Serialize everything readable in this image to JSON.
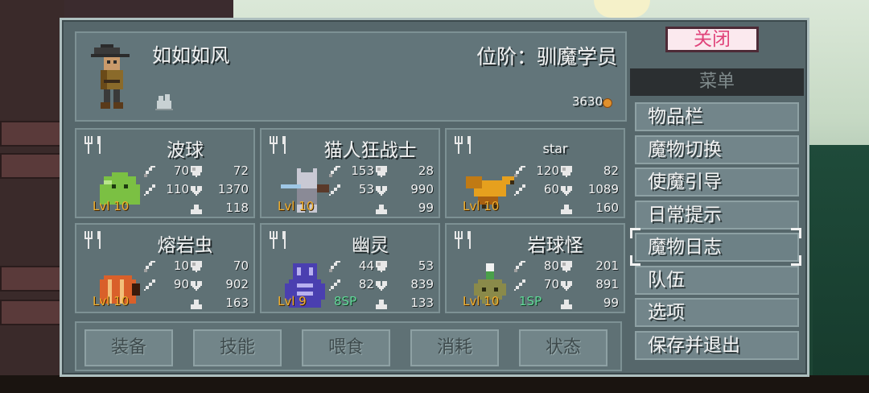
{
  "player": {
    "name": "如如如风",
    "rank": "位阶：驯魔学员",
    "gold": "3630"
  },
  "monsters": [
    {
      "name": "波球",
      "attack": "70",
      "defense": "72",
      "magic": "110",
      "hp": "1370",
      "speed": "118",
      "level": "Lvl 10",
      "sp": "",
      "color": "#7bc043"
    },
    {
      "name": "猫人狂战士",
      "attack": "153",
      "defense": "28",
      "magic": "53",
      "hp": "990",
      "speed": "99",
      "level": "Lvl 10",
      "sp": "",
      "color": "#c9c9d4"
    },
    {
      "name": "star",
      "attack": "120",
      "defense": "82",
      "magic": "60",
      "hp": "1089",
      "speed": "160",
      "level": "Lvl 10",
      "sp": "",
      "color": "#e6a01e"
    },
    {
      "name": "熔岩虫",
      "attack": "10",
      "defense": "70",
      "magic": "90",
      "hp": "902",
      "speed": "163",
      "level": "Lvl 10",
      "sp": "",
      "color": "#d9602a"
    },
    {
      "name": "幽灵",
      "attack": "44",
      "defense": "53",
      "magic": "82",
      "hp": "839",
      "speed": "133",
      "level": "Lvl 9",
      "sp": "8SP",
      "color": "#4a3fb0"
    },
    {
      "name": "岩球怪",
      "attack": "80",
      "defense": "201",
      "magic": "70",
      "hp": "891",
      "speed": "99",
      "level": "Lvl 10",
      "sp": "1SP",
      "color": "#8a8a4a"
    }
  ],
  "actions": [
    "装备",
    "技能",
    "喂食",
    "消耗",
    "状态"
  ],
  "menu": {
    "close_label": "关闭",
    "header": "菜单",
    "items": [
      "物品栏",
      "魔物切换",
      "使魔引导",
      "日常提示",
      "魔物日志",
      "队伍",
      "选项",
      "保存并退出"
    ],
    "selected": "魔物日志"
  },
  "colors": {
    "level": "#f2b02e",
    "sp": "#63d79a",
    "close_text": "#e0447a",
    "gold_coin": "#e0902c"
  },
  "icons": {
    "fork": "fork-knife-icon",
    "attack": "sword-icon",
    "magic": "wand-icon",
    "defense": "shield-icon",
    "hp": "heart-icon",
    "speed": "boot-icon",
    "egg": "pet-egg-icon",
    "coin": "coin-icon"
  }
}
